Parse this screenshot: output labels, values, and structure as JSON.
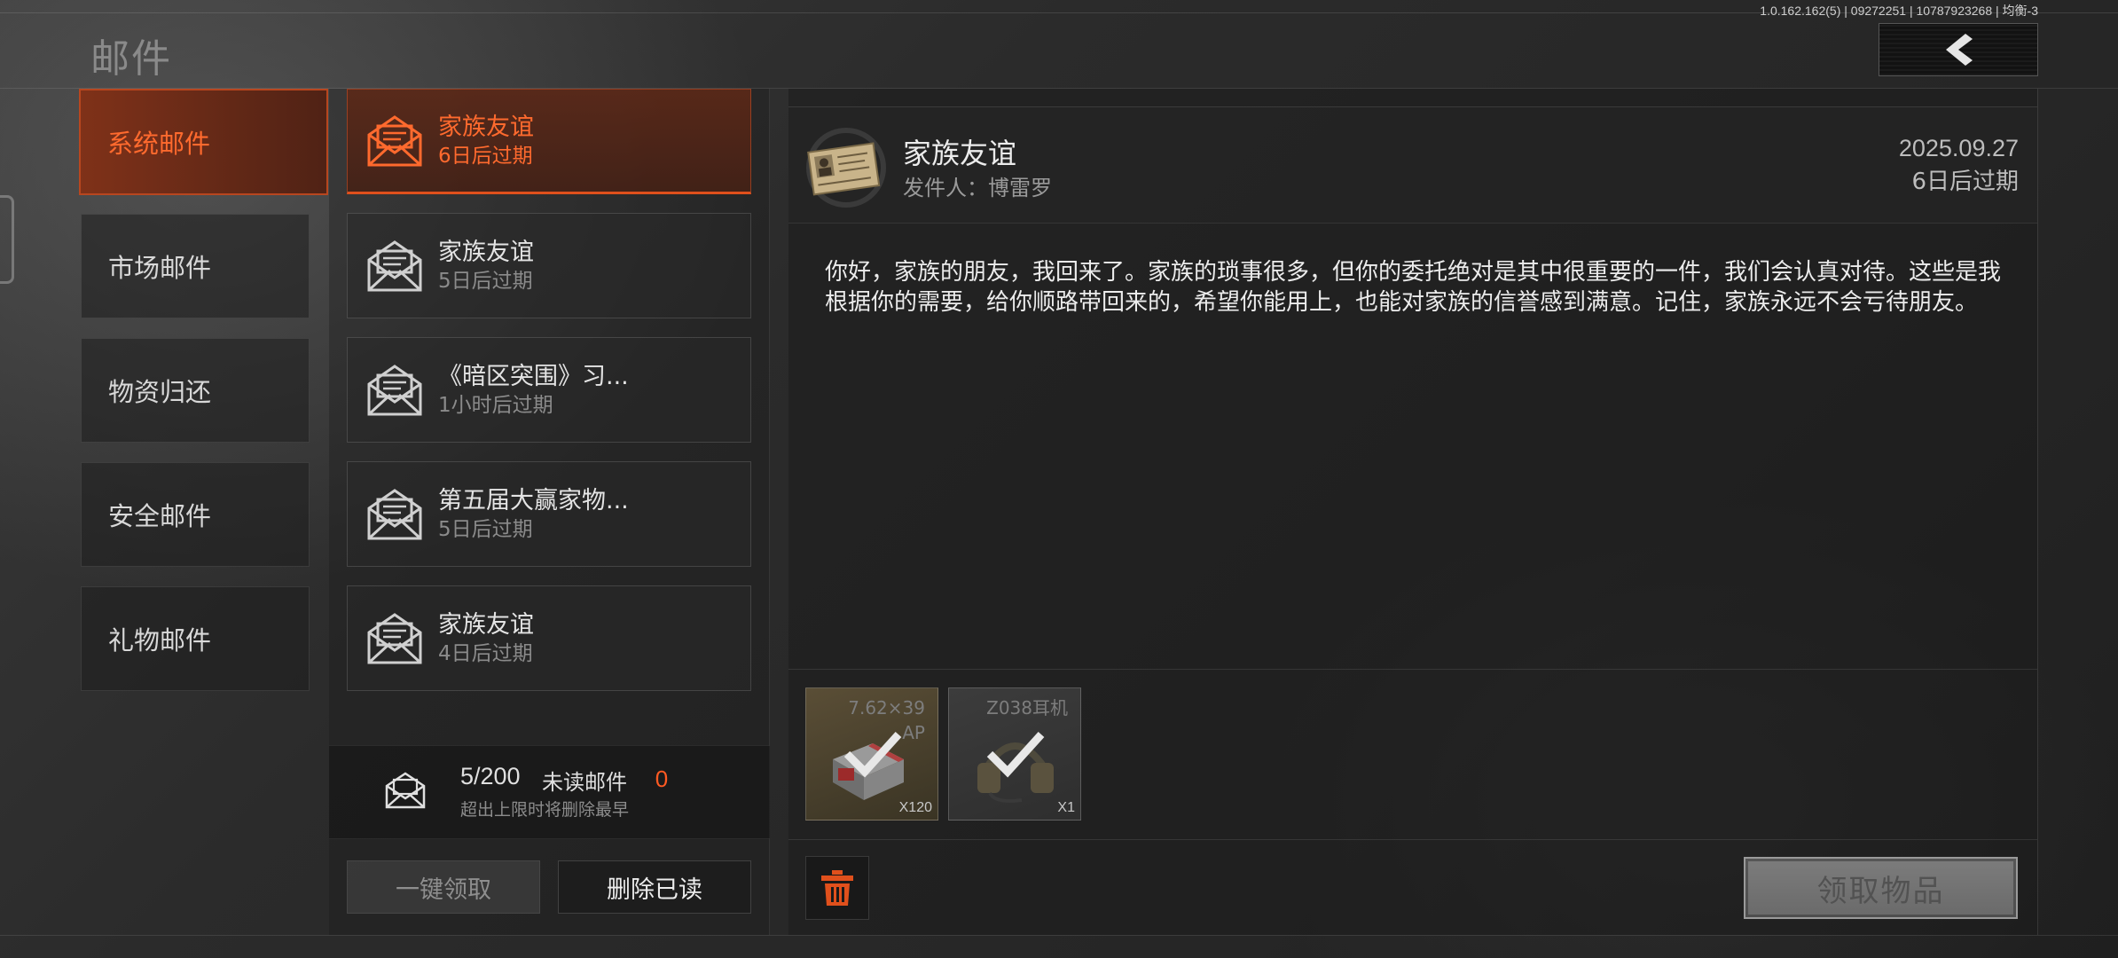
{
  "header": {
    "title": "邮件",
    "version": "1.0.162.162(5) | 09272251 | 10787923268 | 均衡-3",
    "back_icon": "chevron-left-icon"
  },
  "categories": [
    {
      "label": "系统邮件",
      "active": true
    },
    {
      "label": "市场邮件",
      "active": false
    },
    {
      "label": "物资归还",
      "active": false
    },
    {
      "label": "安全邮件",
      "active": false
    },
    {
      "label": "礼物邮件",
      "active": false
    }
  ],
  "mails": [
    {
      "title": "家族友谊",
      "expiry": "6日后过期",
      "active": true
    },
    {
      "title": "家族友谊",
      "expiry": "5日后过期",
      "active": false
    },
    {
      "title": "《暗区突围》习...",
      "expiry": "1小时后过期",
      "active": false
    },
    {
      "title": "第五届大赢家物...",
      "expiry": "5日后过期",
      "active": false
    },
    {
      "title": "家族友谊",
      "expiry": "4日后过期",
      "active": false
    }
  ],
  "mailbox": {
    "count": "5/200",
    "unread_label": "未读邮件",
    "unread_count": "0",
    "limit_note": "超出上限时将删除最早"
  },
  "actions": {
    "claim_all": "一键领取",
    "delete_read": "删除已读",
    "claim_items": "领取物品"
  },
  "detail": {
    "title": "家族友谊",
    "sender": "发件人：博雷罗",
    "date": "2025.09.27",
    "expiry": "6日后过期",
    "body": "你好，家族的朋友，我回来了。家族的琐事很多，但你的委托绝对是其中很重要的一件，我们会认真对待。这些是我根据你的需要，给你顺路带回来的，希望你能用上，也能对家族的信誉感到满意。记住，家族永远不会亏待朋友。"
  },
  "attachments": [
    {
      "name_line1": "7.62×39",
      "name_line2": "AP",
      "qty": "X120",
      "claimed": true
    },
    {
      "name_line1": "Z038耳机",
      "name_line2": "",
      "qty": "X1",
      "claimed": true
    }
  ],
  "colors": {
    "accent": "#ff6a2e",
    "accent_border": "#b8461f",
    "unread_count": "#ff5a22",
    "trash_icon": "#e0501c"
  }
}
